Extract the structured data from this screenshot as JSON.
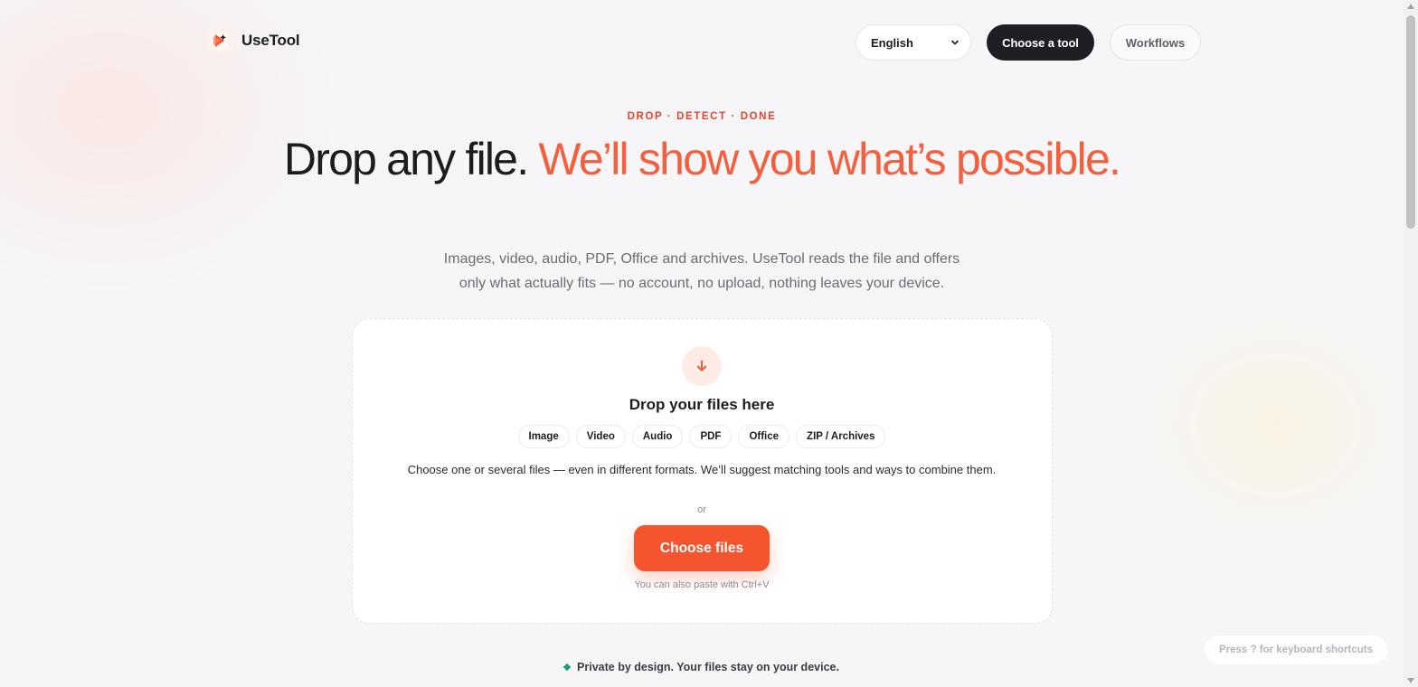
{
  "app": {
    "name": "UseTool",
    "brand_color": "#f5552e",
    "dark_color": "#1d1f24"
  },
  "header": {
    "language_select": {
      "value": "English"
    },
    "choose_tool_label": "Choose a tool",
    "workflows_label": "Workflows"
  },
  "hero": {
    "eyebrow": "DROP · DETECT · DONE",
    "title_part1": "Drop any file.",
    "title_accent": "We’ll show you what’s possible.",
    "subtitle": "Images, video, audio, PDF, Office and archives. UseTool reads the file and offers only what actually fits — no account, no upload, nothing leaves your device."
  },
  "dropzone": {
    "icon": "arrow-down-icon",
    "title": "Drop your files here",
    "chips": [
      "Image",
      "Video",
      "Audio",
      "PDF",
      "Office",
      "ZIP / Archives"
    ],
    "description": "Choose one or several files — even in different formats. We’ll suggest matching tools and ways to combine them.",
    "or_label": "or",
    "button_label": "Choose files",
    "paste_hint": "You can also paste with Ctrl+V"
  },
  "footer": {
    "privacy_note": "Private by design. Your files stay on your device.",
    "privacy_dot_color": "#1f9e72",
    "keyboard_hint": "Press ? for keyboard shortcuts"
  }
}
